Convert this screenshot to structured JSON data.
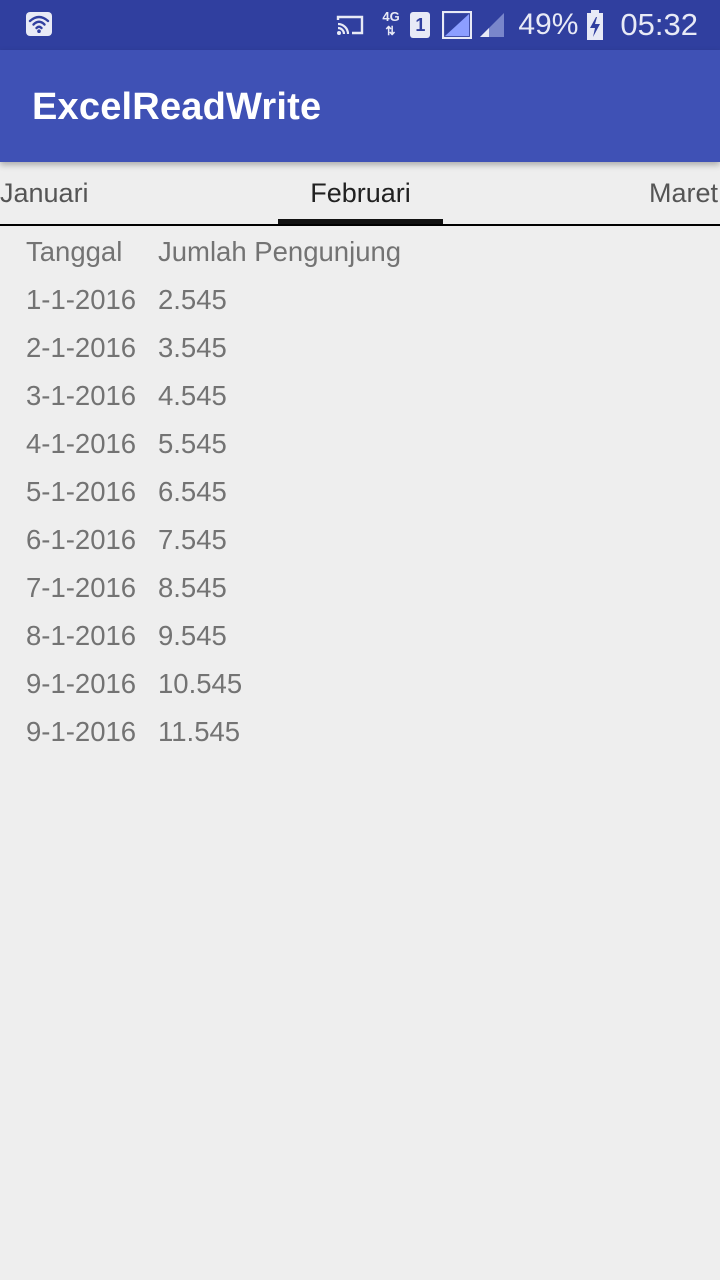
{
  "status_bar": {
    "network_type": "4G",
    "network_arrows": "⇅",
    "sim_slot": "1",
    "battery_percent": "49%",
    "time": "05:32",
    "icons": [
      "wifi-icon",
      "cast-icon",
      "network-4g-icon",
      "sim-1-icon",
      "signal-icon",
      "signal-icon-2",
      "battery-charging-icon"
    ]
  },
  "app_bar": {
    "title": "ExcelReadWrite",
    "color": "#3f51b5",
    "status_color": "#303f9f"
  },
  "tabs": [
    {
      "label": "Januari",
      "selected": false
    },
    {
      "label": "Februari",
      "selected": true
    },
    {
      "label": "Maret",
      "selected": false
    }
  ],
  "table": {
    "headers": [
      "Tanggal",
      "Jumlah Pengunjung"
    ],
    "rows": [
      [
        "1-1-2016",
        "2.545"
      ],
      [
        "2-1-2016",
        "3.545"
      ],
      [
        "3-1-2016",
        "4.545"
      ],
      [
        "4-1-2016",
        "5.545"
      ],
      [
        "5-1-2016",
        "6.545"
      ],
      [
        "6-1-2016",
        "7.545"
      ],
      [
        "7-1-2016",
        "8.545"
      ],
      [
        "8-1-2016",
        "9.545"
      ],
      [
        "9-1-2016",
        "10.545"
      ],
      [
        "9-1-2016",
        "11.545"
      ]
    ]
  }
}
